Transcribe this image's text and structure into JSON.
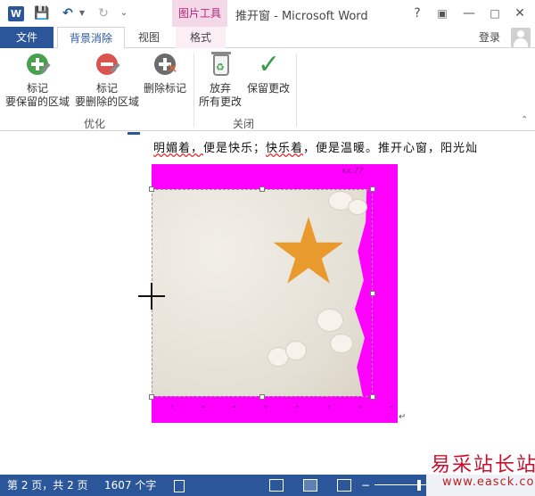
{
  "titlebar": {
    "logo_letter": "W",
    "context_tool": "图片工具",
    "window_title": "推开窗 - Microsoft Word",
    "help": "?",
    "minimize": "—",
    "close": "✕"
  },
  "tabs": {
    "file": "文件",
    "active": "背景消除",
    "view": "视图",
    "format": "格式",
    "login": "登录"
  },
  "ribbon": {
    "keep": {
      "line1": "标记",
      "line2": "要保留的区域"
    },
    "remove": {
      "line1": "标记",
      "line2": "要删除的区域"
    },
    "delete_mark": "删除标记",
    "discard": {
      "line1": "放弃",
      "line2": "所有更改"
    },
    "keep_changes": "保留更改",
    "group_optimize": "优化",
    "group_close": "关闭"
  },
  "document": {
    "line_a": "明媚着，",
    "line_b": "便是快乐；",
    "line_c": "快乐着",
    "line_d": "，便是温暖。推开心窗，阳光灿",
    "picture_caption": "xx.77",
    "paragraph_mark": "↵"
  },
  "statusbar": {
    "page": "第 2 页，共 2 页",
    "words": "1607 个字",
    "zoom_minus": "−"
  },
  "watermark": {
    "site_name": "易采站长站",
    "url": "www.easck.com"
  },
  "colors": {
    "word_blue": "#2b579a",
    "context_pink": "#b5267a",
    "magenta_overlay": "#ff00ff"
  }
}
